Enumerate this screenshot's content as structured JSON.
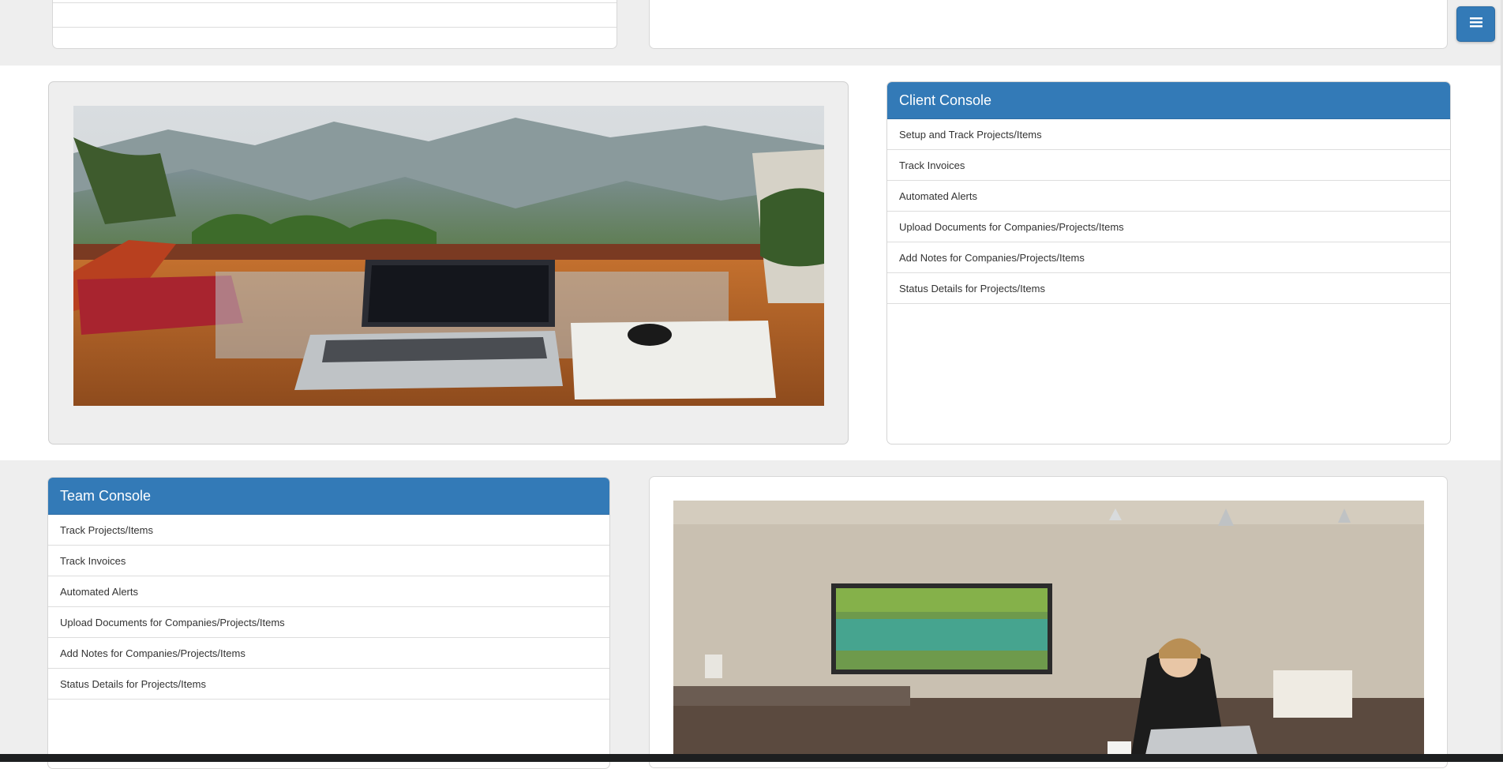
{
  "client_console": {
    "title": "Client Console",
    "items": [
      "Setup and Track Projects/Items",
      "Track Invoices",
      "Automated Alerts",
      "Upload Documents for Companies/Projects/Items",
      "Add Notes for Companies/Projects/Items",
      "Status Details for Projects/Items"
    ]
  },
  "team_console": {
    "title": "Team Console",
    "items": [
      "Track Projects/Items",
      "Track Invoices",
      "Automated Alerts",
      "Upload Documents for Companies/Projects/Items",
      "Add Notes for Companies/Projects/Items",
      "Status Details for Projects/Items"
    ]
  },
  "images": {
    "top_image": "laptop-on-balcony-mountains-photo",
    "bottom_image": "woman-working-laptop-living-room-photo"
  },
  "menu_button_icon": "hamburger-menu-icon",
  "colors": {
    "primary": "#337ab7",
    "band_grey": "#eeeeee"
  }
}
